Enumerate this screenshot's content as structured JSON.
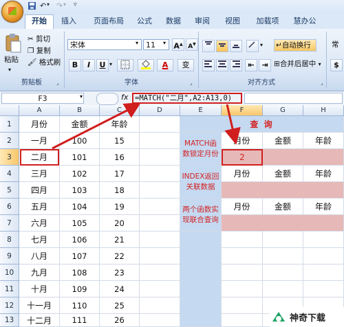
{
  "ribbon": {
    "tabs": [
      "开始",
      "插入",
      "页面布局",
      "公式",
      "数据",
      "审阅",
      "视图",
      "加载项",
      "慧办公"
    ],
    "active_tab": "开始",
    "clipboard": {
      "paste": "粘贴",
      "cut": "剪切",
      "copy": "复制",
      "format_painter": "格式刷",
      "label": "剪贴板"
    },
    "font": {
      "name": "宋体",
      "size": "11",
      "bold": "B",
      "italic": "I",
      "underline": "U",
      "wen": "变",
      "label": "字体"
    },
    "align": {
      "wrap": "自动换行",
      "merge": "合并后居中",
      "label": "对齐方式"
    }
  },
  "formula_bar": {
    "name_box": "F3",
    "fx": "fx",
    "formula": "=MATCH(\"二月\",A2:A13,0)"
  },
  "columns": [
    "A",
    "B",
    "C",
    "D",
    "E",
    "F",
    "G",
    "H"
  ],
  "rows": [
    "1",
    "2",
    "3",
    "4",
    "5",
    "6",
    "7",
    "8",
    "9",
    "10",
    "11",
    "12",
    "13"
  ],
  "table": {
    "headers": [
      "月份",
      "金额",
      "年龄"
    ],
    "data": [
      [
        "一月",
        "100",
        "15"
      ],
      [
        "二月",
        "101",
        "16"
      ],
      [
        "三月",
        "102",
        "17"
      ],
      [
        "四月",
        "103",
        "18"
      ],
      [
        "五月",
        "104",
        "19"
      ],
      [
        "六月",
        "105",
        "20"
      ],
      [
        "七月",
        "106",
        "21"
      ],
      [
        "八月",
        "107",
        "22"
      ],
      [
        "九月",
        "108",
        "23"
      ],
      [
        "十月",
        "109",
        "24"
      ],
      [
        "十一月",
        "110",
        "25"
      ],
      [
        "十二月",
        "111",
        "26"
      ]
    ]
  },
  "query": {
    "title": "查 询",
    "match_label": "MATCH函数锁定月份",
    "index_label": "INDEX返回关联数据",
    "combo_label": "两个函数实现联合查询",
    "col_month": "月份",
    "col_amount": "金额",
    "col_age": "年龄",
    "result": "2"
  },
  "watermark": {
    "text": "神奇下载"
  },
  "colors": {
    "accent": "#d01e1e",
    "header_blue": "#c5d9f1",
    "result_pink": "#e6b8b7"
  }
}
